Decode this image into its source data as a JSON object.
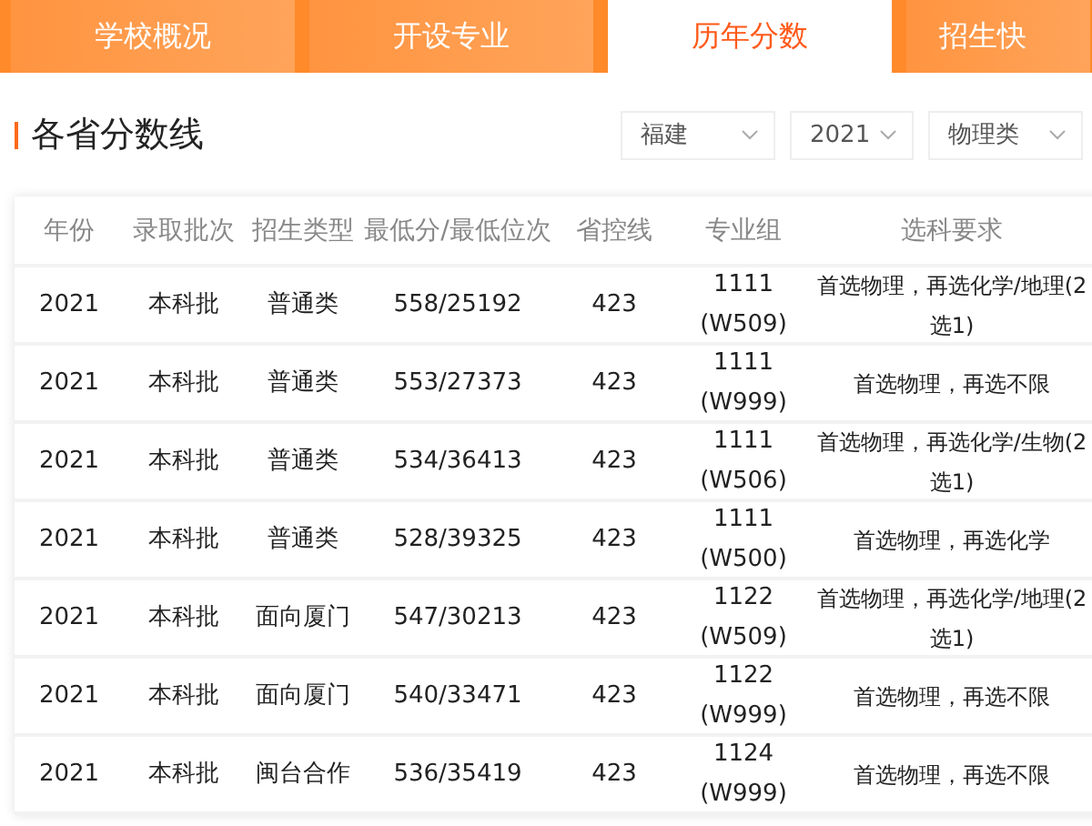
{
  "tabs": [
    {
      "label": "学校概况",
      "selected": false
    },
    {
      "label": "开设专业",
      "selected": false
    },
    {
      "label": "历年分数",
      "selected": true
    },
    {
      "label": "招生快",
      "selected": false
    }
  ],
  "section": {
    "title": "各省分数线",
    "filters": [
      {
        "value": "福建"
      },
      {
        "value": "2021"
      },
      {
        "value": "物理类"
      }
    ]
  },
  "table": {
    "columns": [
      "年份",
      "录取批次",
      "招生类型",
      "最低分/最低位次",
      "省控线",
      "专业组",
      "选科要求"
    ],
    "rows": [
      [
        "2021",
        "本科批",
        "普通类",
        "558/25192",
        "423",
        "1111\n(W509)",
        "首选物理，再选化学/地理(2选1)"
      ],
      [
        "2021",
        "本科批",
        "普通类",
        "553/27373",
        "423",
        "1111\n(W999)",
        "首选物理，再选不限"
      ],
      [
        "2021",
        "本科批",
        "普通类",
        "534/36413",
        "423",
        "1111\n(W506)",
        "首选物理，再选化学/生物(2选1)"
      ],
      [
        "2021",
        "本科批",
        "普通类",
        "528/39325",
        "423",
        "1111\n(W500)",
        "首选物理，再选化学"
      ],
      [
        "2021",
        "本科批",
        "面向厦门",
        "547/30213",
        "423",
        "1122\n(W509)",
        "首选物理，再选化学/地理(2选1)"
      ],
      [
        "2021",
        "本科批",
        "面向厦门",
        "540/33471",
        "423",
        "1122\n(W999)",
        "首选物理，再选不限"
      ],
      [
        "2021",
        "本科批",
        "闽台合作",
        "536/35419",
        "423",
        "1124\n(W999)",
        "首选物理，再选不限"
      ]
    ]
  }
}
